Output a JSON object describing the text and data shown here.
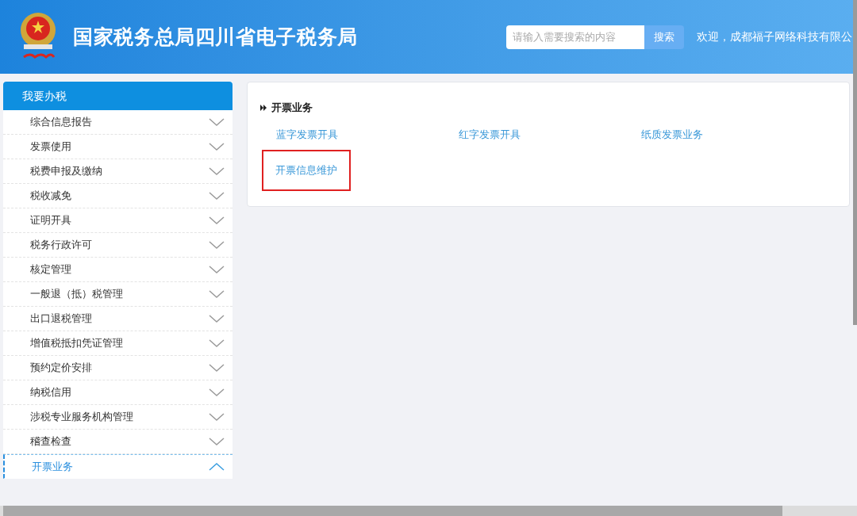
{
  "header": {
    "title": "国家税务总局四川省电子税务局",
    "search": {
      "placeholder": "请输入需要搜索的内容",
      "button": "搜索"
    },
    "welcome": "欢迎，成都福子网络科技有限公"
  },
  "sidebar": {
    "title": "我要办税",
    "items": [
      {
        "label": "综合信息报告",
        "expanded": false
      },
      {
        "label": "发票使用",
        "expanded": false
      },
      {
        "label": "税费申报及缴纳",
        "expanded": false
      },
      {
        "label": "税收减免",
        "expanded": false
      },
      {
        "label": "证明开具",
        "expanded": false
      },
      {
        "label": "税务行政许可",
        "expanded": false
      },
      {
        "label": "核定管理",
        "expanded": false
      },
      {
        "label": "一般退（抵）税管理",
        "expanded": false
      },
      {
        "label": "出口退税管理",
        "expanded": false
      },
      {
        "label": "增值税抵扣凭证管理",
        "expanded": false
      },
      {
        "label": "预约定价安排",
        "expanded": false
      },
      {
        "label": "纳税信用",
        "expanded": false
      },
      {
        "label": "涉税专业服务机构管理",
        "expanded": false
      },
      {
        "label": "稽查检查",
        "expanded": false
      },
      {
        "label": "开票业务",
        "expanded": true
      }
    ]
  },
  "content": {
    "section_title": "开票业务",
    "links": [
      {
        "label": "蓝字发票开具",
        "highlighted": false
      },
      {
        "label": "红字发票开具",
        "highlighted": false
      },
      {
        "label": "纸质发票业务",
        "highlighted": false
      },
      {
        "label": "开票信息维护",
        "highlighted": true
      }
    ]
  }
}
